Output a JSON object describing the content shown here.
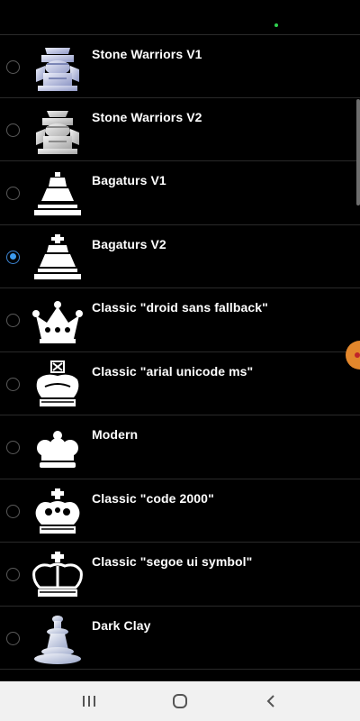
{
  "piece_sets": [
    {
      "label": "Stone Warriors V1",
      "icon": "stone-warrior-king-icon",
      "selected": false
    },
    {
      "label": "Stone Warriors V2",
      "icon": "stone-warrior-king-icon",
      "selected": false
    },
    {
      "label": "Bagaturs V1",
      "icon": "bagatur-king-icon",
      "selected": false
    },
    {
      "label": "Bagaturs V2",
      "icon": "bagatur-king-icon",
      "selected": true
    },
    {
      "label": "Classic \"droid sans fallback\"",
      "icon": "crown-king-icon",
      "selected": false
    },
    {
      "label": "Classic \"arial unicode ms\"",
      "icon": "cross-king-icon",
      "selected": false
    },
    {
      "label": "Modern",
      "icon": "modern-king-icon",
      "selected": false
    },
    {
      "label": "Classic \"code 2000\"",
      "icon": "ornate-king-icon",
      "selected": false
    },
    {
      "label": "Classic \"segoe ui symbol\"",
      "icon": "segoe-king-icon",
      "selected": false
    },
    {
      "label": "Dark Clay",
      "icon": "clay-king-icon",
      "selected": false
    }
  ],
  "colors": {
    "accent": "#3d9cf0",
    "background": "#000000",
    "divider": "#2a2a2a",
    "navbar": "#f1f1f1"
  },
  "navbar": {
    "recents": "recents-icon",
    "home": "home-icon",
    "back": "back-icon"
  }
}
